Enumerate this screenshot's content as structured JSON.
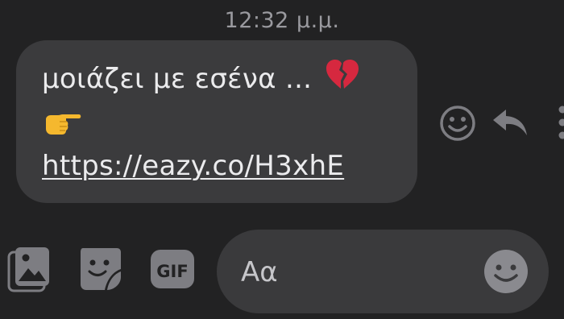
{
  "timestamp": "12:32 μ.μ.",
  "message": {
    "line1_text": "μοιάζει με εσένα ...",
    "line1_emoji": "broken-heart",
    "line2_emoji": "pointing-right-hand",
    "link": "https://eazy.co/H3xhE"
  },
  "message_actions": {
    "react_icon": "smiley-face-icon",
    "reply_icon": "reply-arrow-icon",
    "more_icon": "vertical-ellipsis-icon"
  },
  "composer": {
    "photo_icon": "photo-gallery-icon",
    "sticker_icon": "sticker-icon",
    "gif_label": "GIF",
    "placeholder": "Αα",
    "emoji_icon": "smiley-face-icon"
  },
  "colors": {
    "background": "#222223",
    "bubble": "#3b3b3d",
    "text": "#ebebed",
    "muted": "#9a9a9f",
    "icon": "#7d7d82"
  }
}
